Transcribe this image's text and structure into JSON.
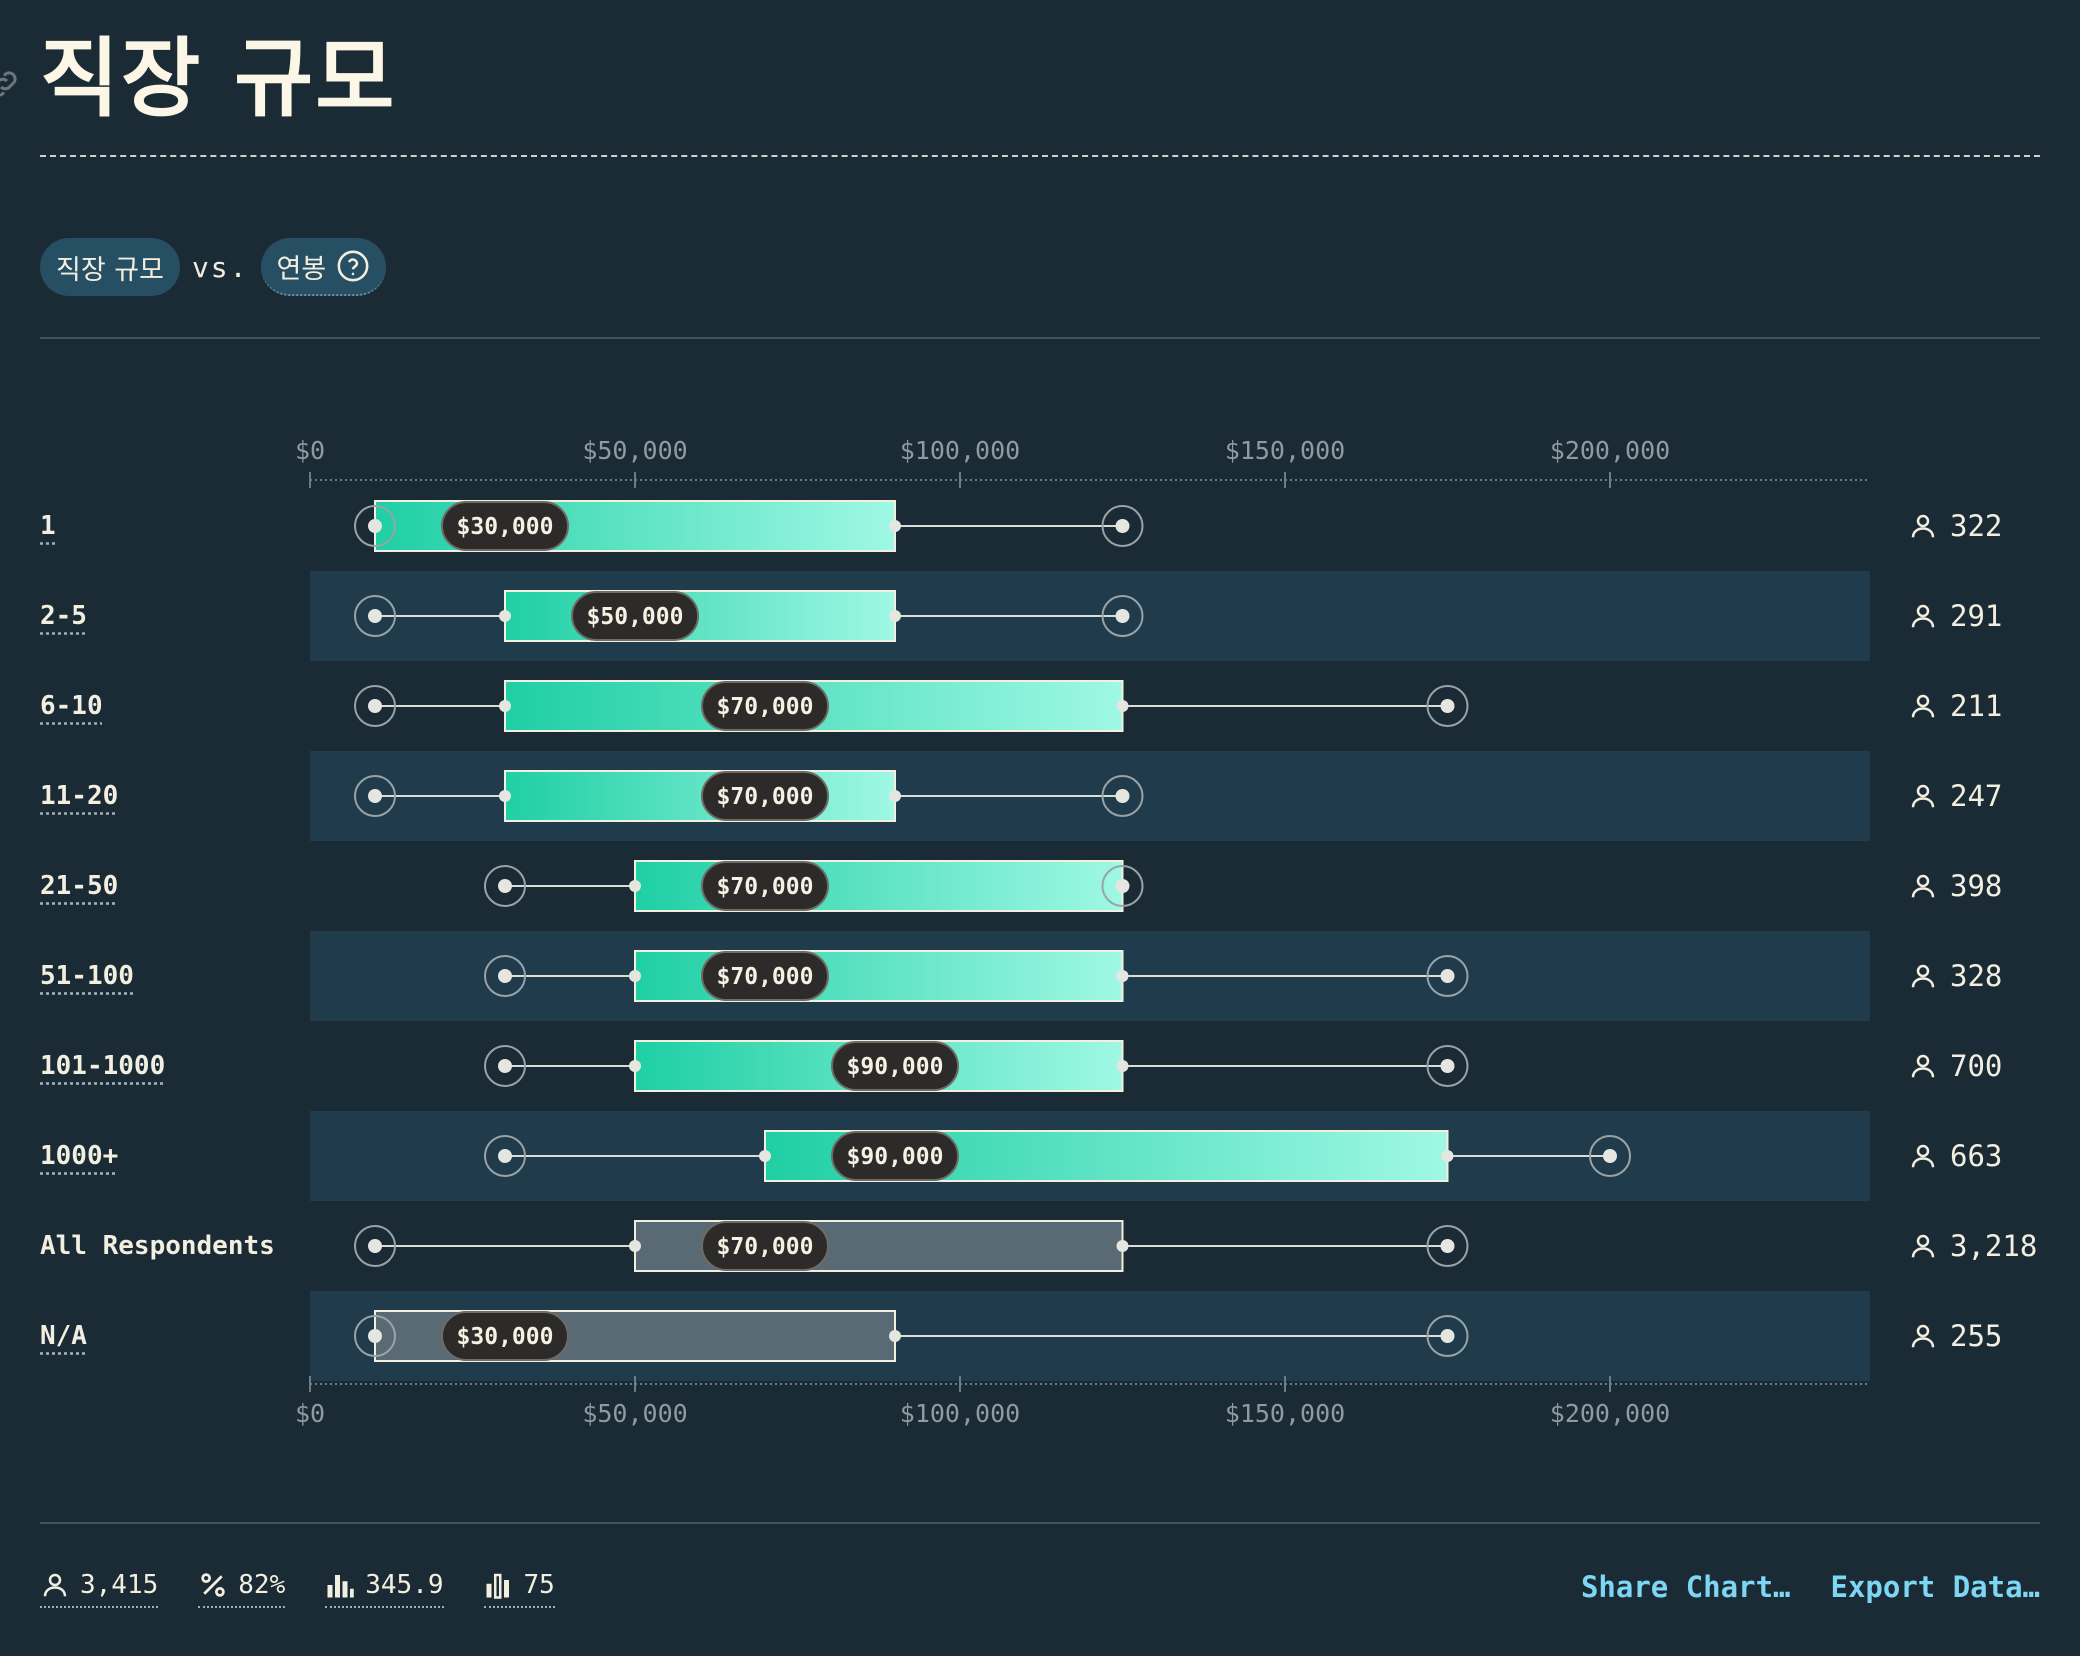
{
  "page": {
    "title": "직장 규모",
    "selector": {
      "left": "직장 규모",
      "vs": "vs.",
      "right": "연봉"
    }
  },
  "footer": {
    "stats": [
      {
        "icon": "person-icon",
        "value": "3,415"
      },
      {
        "icon": "percent-icon",
        "value": "82%"
      },
      {
        "icon": "bar-chart-icon",
        "value": "345.9"
      },
      {
        "icon": "bar-chart-outline-icon",
        "value": "75"
      }
    ],
    "share": "Share Chart…",
    "export": "Export Data…"
  },
  "chart_data": {
    "type": "boxplot",
    "xlim": [
      0,
      240000
    ],
    "ticks": [
      0,
      50000,
      100000,
      150000,
      200000
    ],
    "tick_labels": [
      "$0",
      "$50,000",
      "$100,000",
      "$150,000",
      "$200,000"
    ],
    "colors": {
      "box_start": "#1fcfa4",
      "box_end": "#9ff8e4",
      "box_neutral": "#5a6a74",
      "row_band": "#203b4b",
      "median_pill": "#2d2b29",
      "whisker": "#dcdcd6"
    },
    "rows": [
      {
        "label": "1",
        "p10": 10000,
        "p25": 10000,
        "median": 30000,
        "p75": 90000,
        "p90": 125000,
        "count": "322",
        "neutral": false
      },
      {
        "label": "2-5",
        "p10": 10000,
        "p25": 30000,
        "median": 50000,
        "p75": 90000,
        "p90": 125000,
        "count": "291",
        "neutral": false
      },
      {
        "label": "6-10",
        "p10": 10000,
        "p25": 30000,
        "median": 70000,
        "p75": 125000,
        "p90": 175000,
        "count": "211",
        "neutral": false
      },
      {
        "label": "11-20",
        "p10": 10000,
        "p25": 30000,
        "median": 70000,
        "p75": 90000,
        "p90": 125000,
        "count": "247",
        "neutral": false
      },
      {
        "label": "21-50",
        "p10": 30000,
        "p25": 50000,
        "median": 70000,
        "p75": 125000,
        "p90": 125000,
        "count": "398",
        "neutral": false
      },
      {
        "label": "51-100",
        "p10": 30000,
        "p25": 50000,
        "median": 70000,
        "p75": 125000,
        "p90": 175000,
        "count": "328",
        "neutral": false
      },
      {
        "label": "101-1000",
        "p10": 30000,
        "p25": 50000,
        "median": 90000,
        "p75": 125000,
        "p90": 175000,
        "count": "700",
        "neutral": false
      },
      {
        "label": "1000+",
        "p10": 30000,
        "p25": 70000,
        "median": 90000,
        "p75": 175000,
        "p90": 200000,
        "count": "663",
        "neutral": false
      },
      {
        "label": "All Respondents",
        "p10": 10000,
        "p25": 50000,
        "median": 70000,
        "p75": 125000,
        "p90": 175000,
        "count": "3,218",
        "neutral": true
      },
      {
        "label": "N/A",
        "p10": 10000,
        "p25": 10000,
        "median": 30000,
        "p75": 90000,
        "p90": 175000,
        "count": "255",
        "neutral": true
      }
    ]
  }
}
